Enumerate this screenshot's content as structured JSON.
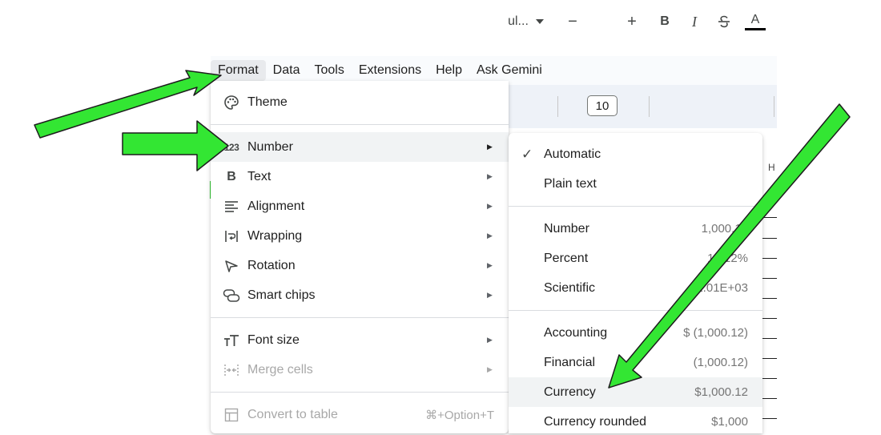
{
  "menubar": {
    "items": [
      "Format",
      "Data",
      "Tools",
      "Extensions",
      "Help",
      "Ask Gemini"
    ]
  },
  "toolbar": {
    "font_name_fragment": "ul...",
    "font_size": "10",
    "minus": "−",
    "plus": "+",
    "bold": "B",
    "italic": "I",
    "text_color": "A"
  },
  "sheet": {
    "col_header_fragment": "H"
  },
  "format_menu": {
    "items": [
      {
        "label": "Theme",
        "icon": "palette-icon"
      },
      {
        "label": "Number",
        "icon": "number-format-icon",
        "icon_text": "123",
        "has_submenu": true
      },
      {
        "label": "Text",
        "icon": "bold-icon",
        "has_submenu": true
      },
      {
        "label": "Alignment",
        "icon": "align-left-icon",
        "has_submenu": true
      },
      {
        "label": "Wrapping",
        "icon": "wrap-icon",
        "has_submenu": true
      },
      {
        "label": "Rotation",
        "icon": "rotation-icon",
        "has_submenu": true
      },
      {
        "label": "Smart chips",
        "icon": "smart-chips-icon",
        "has_submenu": true
      },
      {
        "label": "Font size",
        "icon": "font-size-icon",
        "has_submenu": true
      },
      {
        "label": "Merge cells",
        "icon": "merge-cells-icon",
        "has_submenu": true,
        "disabled": true
      },
      {
        "label": "Convert to table",
        "icon": "table-icon",
        "shortcut": "⌘+Option+T",
        "disabled": true
      }
    ]
  },
  "number_submenu": {
    "items": [
      {
        "label": "Automatic",
        "checked": true,
        "value": ""
      },
      {
        "label": "Plain text",
        "value": ""
      },
      {
        "label": "Number",
        "value": "1,000.12"
      },
      {
        "label": "Percent",
        "value": "10.12%"
      },
      {
        "label": "Scientific",
        "value": "1.01E+03"
      },
      {
        "label": "Accounting",
        "value": "$ (1,000.12)"
      },
      {
        "label": "Financial",
        "value": "(1,000.12)"
      },
      {
        "label": "Currency",
        "value": "$1,000.12"
      },
      {
        "label": "Currency rounded",
        "value": "$1,000"
      }
    ]
  },
  "colors": {
    "arrow": "#33e633",
    "arrow_outline": "#1d1d1d",
    "highlight": "#f1f3f4",
    "menubar_bg": "#f9fbfd",
    "toolbar_bg": "#eef2f8"
  }
}
